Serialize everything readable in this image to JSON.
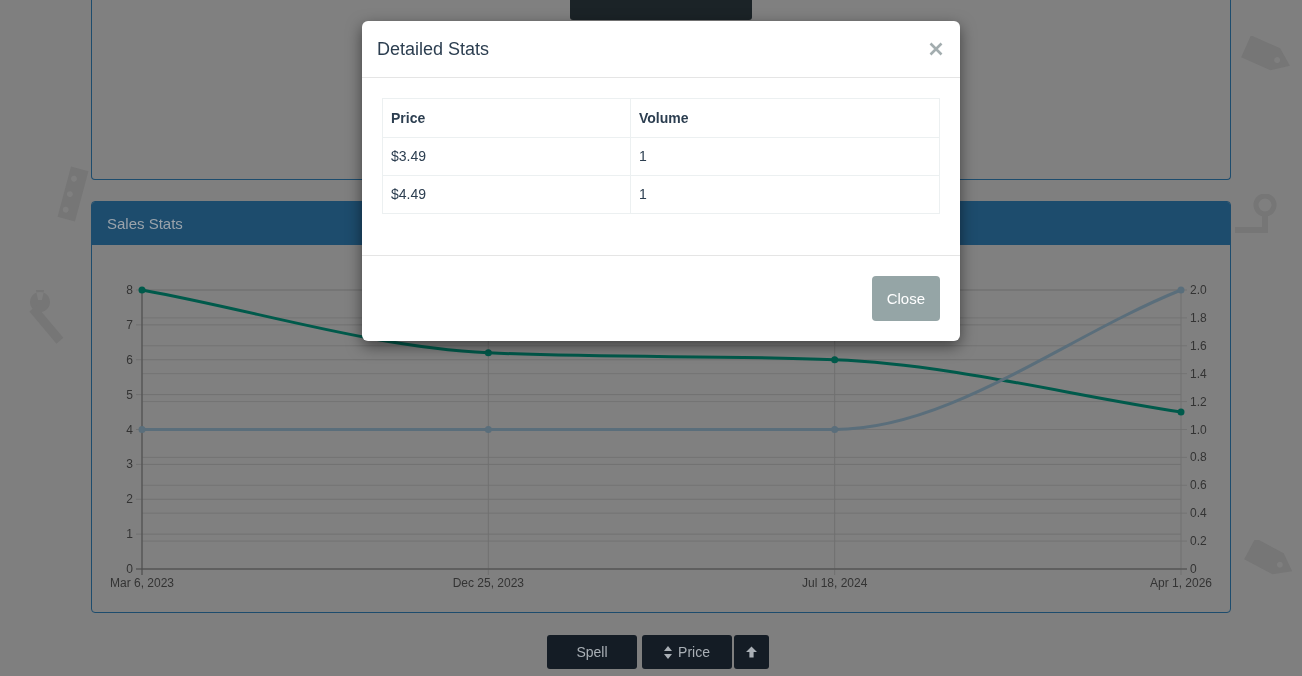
{
  "sales_stats": {
    "title": "Sales Stats",
    "chart_data": {
      "type": "line",
      "categories": [
        "Mar 6, 2023",
        "Dec 25, 2023",
        "Jul 18, 2024",
        "Apr 1, 2026"
      ],
      "series": [
        {
          "color": "#005a4b",
          "axis": "y",
          "marker": "circle",
          "values": [
            8,
            6.2,
            6,
            4.5
          ]
        },
        {
          "color": "#5a6e7b",
          "axis": "y2",
          "marker": "circle",
          "values": [
            1,
            1,
            1,
            2
          ]
        }
      ],
      "grid": true,
      "ylim": [
        0,
        8
      ],
      "yticks": [
        0,
        1,
        2,
        3,
        4,
        5,
        6,
        7,
        8
      ],
      "y2lim": [
        0,
        2
      ],
      "y2ticks": [
        {
          "value": 0,
          "label": "0"
        },
        {
          "value": 0.2,
          "label": "0.2"
        },
        {
          "value": 0.4,
          "label": "0.4"
        },
        {
          "value": 0.6,
          "label": "0.6"
        },
        {
          "value": 0.8,
          "label": "0.8"
        },
        {
          "value": 1,
          "label": "1.0"
        },
        {
          "value": 1.2,
          "label": "1.2"
        },
        {
          "value": 1.4,
          "label": "1.4"
        },
        {
          "value": 1.6,
          "label": "1.6"
        },
        {
          "value": 1.8,
          "label": "1.8"
        },
        {
          "value": 2,
          "label": "2.0"
        }
      ]
    }
  },
  "toolbar": {
    "buttons": [
      {
        "kind": "text",
        "label": "Spell"
      },
      {
        "kind": "sort",
        "label": "Price"
      },
      {
        "kind": "arrow"
      }
    ]
  },
  "modal": {
    "title": "Detailed Stats",
    "table": {
      "columns": [
        "Price",
        "Volume"
      ],
      "rows": [
        [
          "$3.49",
          "1"
        ],
        [
          "$4.49",
          "1"
        ]
      ]
    },
    "buttons": [
      "Close"
    ]
  }
}
